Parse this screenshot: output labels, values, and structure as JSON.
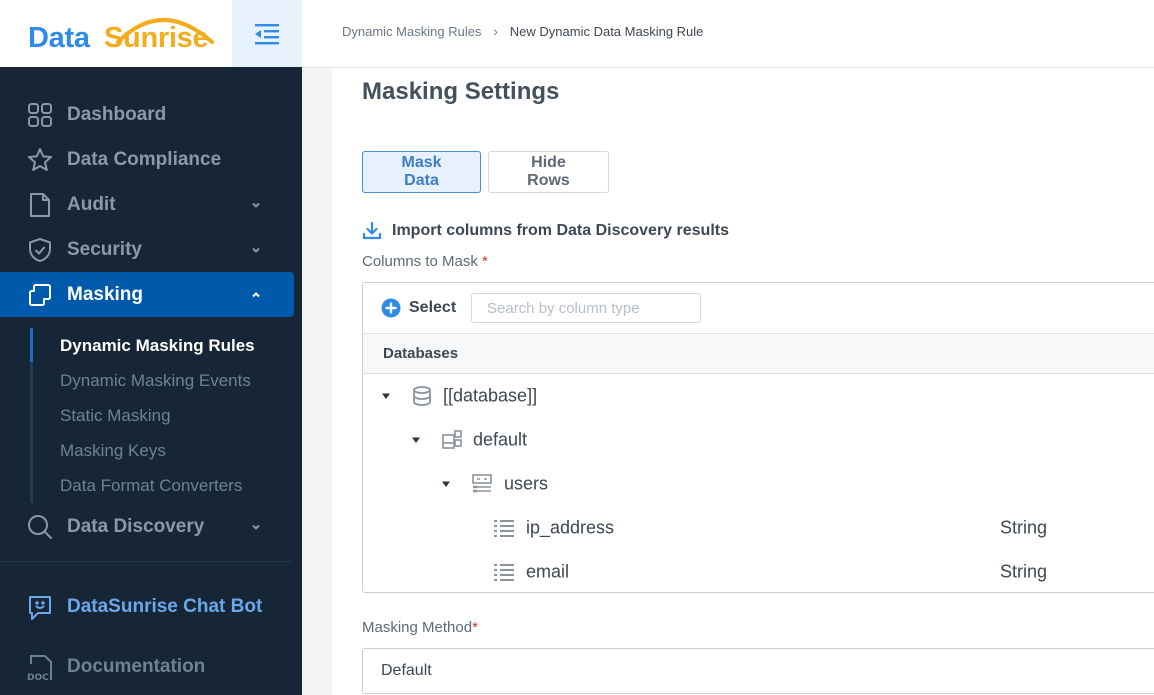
{
  "brand": {
    "name_part1": "Data",
    "name_part2": "Sunrise",
    "primary_color": "#2f8ae8",
    "accent_color": "#f5ac1c"
  },
  "sidebar": {
    "collapse_icon": "indent-decrease-icon",
    "items": [
      {
        "label": "Dashboard",
        "icon": "grid-icon",
        "has_chevron": false,
        "active": false
      },
      {
        "label": "Data Compliance",
        "icon": "star-icon",
        "has_chevron": false,
        "active": false
      },
      {
        "label": "Audit",
        "icon": "file-icon",
        "has_chevron": true,
        "active": false
      },
      {
        "label": "Security",
        "icon": "shield-check-icon",
        "has_chevron": true,
        "active": false
      },
      {
        "label": "Masking",
        "icon": "masking-icon",
        "has_chevron": true,
        "active": true,
        "expanded": true
      },
      {
        "label": "Data Discovery",
        "icon": "search-icon",
        "has_chevron": true,
        "active": false
      }
    ],
    "masking_subitems": [
      {
        "label": "Dynamic Masking Rules",
        "active": true
      },
      {
        "label": "Dynamic Masking Events",
        "active": false
      },
      {
        "label": "Static Masking",
        "active": false
      },
      {
        "label": "Masking Keys",
        "active": false
      },
      {
        "label": "Data Format Converters",
        "active": false
      }
    ],
    "chatbot_label": "DataSunrise Chat Bot",
    "docs_label": "Documentation",
    "active_color": "#005aab",
    "background_color": "#172636"
  },
  "breadcrumb": {
    "parent": "Dynamic Masking Rules",
    "separator": "›",
    "current": "New Dynamic Data Masking Rule"
  },
  "main": {
    "section_title": "Masking Settings",
    "mode_toggle": {
      "options": [
        "Mask Data",
        "Hide Rows"
      ],
      "selected": "Mask Data"
    },
    "import_link": "Import columns from Data Discovery results",
    "columns_label": "Columns to Mask",
    "required_mark": "*",
    "select_button": "Select",
    "search_placeholder": "Search by column type",
    "search_value": "",
    "tree_header": "Databases",
    "tree": [
      {
        "level": 0,
        "name": "[[database]]",
        "icon": "database-icon",
        "expanded": true,
        "type": ""
      },
      {
        "level": 1,
        "name": "default",
        "icon": "schema-icon",
        "expanded": true,
        "type": ""
      },
      {
        "level": 2,
        "name": "users",
        "icon": "table-icon",
        "expanded": true,
        "type": ""
      },
      {
        "level": 3,
        "name": "ip_address",
        "icon": "column-icon",
        "expanded": false,
        "type": "String"
      },
      {
        "level": 3,
        "name": "email",
        "icon": "column-icon",
        "expanded": false,
        "type": "String"
      }
    ],
    "masking_method_label": "Masking Method",
    "masking_method_value": "Default"
  }
}
